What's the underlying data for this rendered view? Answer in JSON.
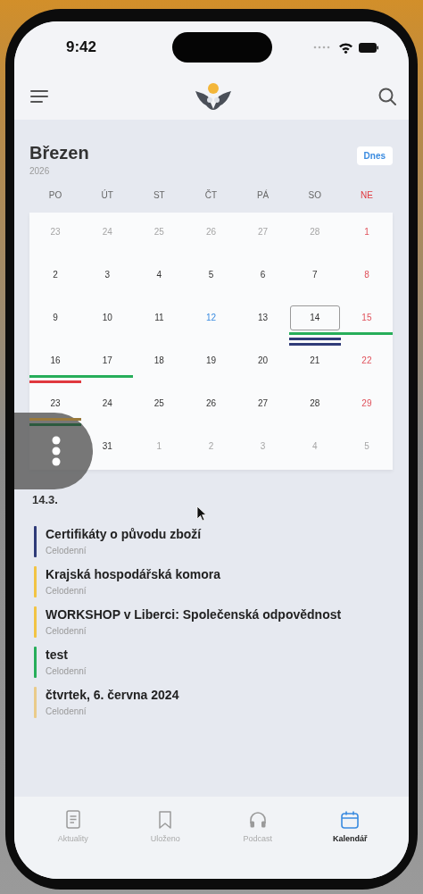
{
  "status_bar": {
    "time": "9:42"
  },
  "header": {
    "today_button": "Dnes"
  },
  "calendar": {
    "month": "Březen",
    "year": "2026",
    "weekdays": [
      {
        "label": "PO",
        "sunday": false
      },
      {
        "label": "ÚT",
        "sunday": false
      },
      {
        "label": "ST",
        "sunday": false
      },
      {
        "label": "ČT",
        "sunday": false
      },
      {
        "label": "PÁ",
        "sunday": false
      },
      {
        "label": "SO",
        "sunday": false
      },
      {
        "label": "NE",
        "sunday": true
      }
    ],
    "weeks": [
      [
        {
          "day": "23",
          "muted": true
        },
        {
          "day": "24",
          "muted": true
        },
        {
          "day": "25",
          "muted": true
        },
        {
          "day": "26",
          "muted": true
        },
        {
          "day": "27",
          "muted": true
        },
        {
          "day": "28",
          "muted": true
        },
        {
          "day": "1",
          "sunday": true
        }
      ],
      [
        {
          "day": "2"
        },
        {
          "day": "3"
        },
        {
          "day": "4"
        },
        {
          "day": "5"
        },
        {
          "day": "6"
        },
        {
          "day": "7"
        },
        {
          "day": "8",
          "sunday": true
        }
      ],
      [
        {
          "day": "9"
        },
        {
          "day": "10"
        },
        {
          "day": "11"
        },
        {
          "day": "12",
          "today": true
        },
        {
          "day": "13"
        },
        {
          "day": "14",
          "selected": true,
          "bars": [
            {
              "color": "#27ae5a"
            },
            {
              "color": "#2f3b78"
            },
            {
              "color": "#2f3b78"
            }
          ]
        },
        {
          "day": "15",
          "sunday": true,
          "bars": [
            {
              "color": "#27ae5a"
            }
          ]
        }
      ],
      [
        {
          "day": "16",
          "bars": [
            {
              "color": "#27ae5a"
            },
            {
              "color": "#e0383e"
            }
          ]
        },
        {
          "day": "17",
          "bars": [
            {
              "color": "#27ae5a"
            }
          ]
        },
        {
          "day": "18"
        },
        {
          "day": "19"
        },
        {
          "day": "20"
        },
        {
          "day": "21"
        },
        {
          "day": "22",
          "sunday": true
        }
      ],
      [
        {
          "day": "23",
          "bars": [
            {
              "color": "#9a7a3c"
            },
            {
              "color": "#2c5a3e"
            }
          ]
        },
        {
          "day": "24"
        },
        {
          "day": "25"
        },
        {
          "day": "26"
        },
        {
          "day": "27"
        },
        {
          "day": "28"
        },
        {
          "day": "29",
          "sunday": true
        }
      ],
      [
        {
          "day": "31"
        },
        {
          "day": "1",
          "muted": true
        },
        {
          "day": "2",
          "muted": true
        },
        {
          "day": "3",
          "muted": true
        },
        {
          "day": "4",
          "muted": true
        },
        {
          "day": "5",
          "muted": true
        }
      ]
    ]
  },
  "agenda": {
    "date": "14.3.",
    "events": [
      {
        "title": "Certifikáty o původu zboží",
        "subtitle": "Celodenní",
        "color": "#2f3b78"
      },
      {
        "title": "Krajská hospodářská komora",
        "subtitle": "Celodenní",
        "color": "#f2c444"
      },
      {
        "title": "WORKSHOP v Liberci: Společenská odpovědnost",
        "subtitle": "Celodenní",
        "color": "#f2c444"
      },
      {
        "title": "test",
        "subtitle": "Celodenní",
        "color": "#27ae5a"
      },
      {
        "title": "čtvrtek, 6. června 2024",
        "subtitle": "Celodenní",
        "color": "#eacb8a"
      }
    ]
  },
  "tabs": [
    {
      "label": "Aktuality",
      "selected": false
    },
    {
      "label": "Uloženo",
      "selected": false
    },
    {
      "label": "Podcast",
      "selected": false
    },
    {
      "label": "Kalendář",
      "selected": true
    }
  ]
}
